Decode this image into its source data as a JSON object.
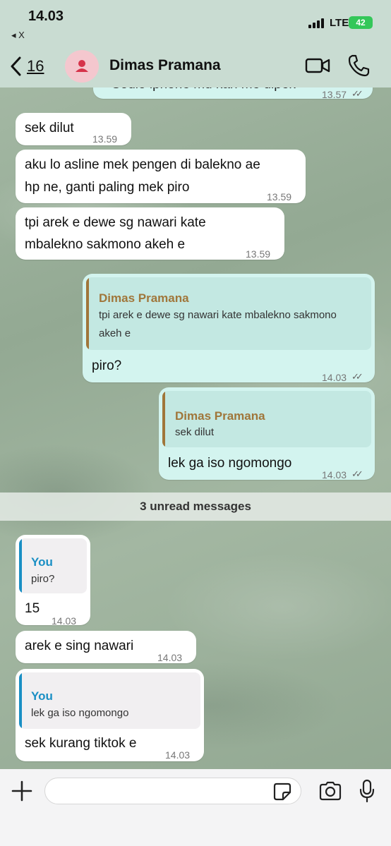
{
  "status_bar": {
    "time": "14.03",
    "back_label": "◂ X",
    "network": "LTE",
    "battery": "42"
  },
  "header": {
    "back_count": "16",
    "contact_name": "Dimas Pramana"
  },
  "messages": [
    {
      "partial_text": "Sodio iphone mu kan me dipek",
      "time": "13.57"
    },
    {
      "text": "sek dilut",
      "time": "13.59"
    },
    {
      "line1": "aku lo asline mek pengen di balekno ae",
      "line2": "hp ne, ganti paling mek piro",
      "time": "13.59"
    },
    {
      "line1": "tpi arek e dewe sg nawari kate",
      "line2": "mbalekno sakmono akeh e",
      "time": "13.59"
    },
    {
      "quote_name": "Dimas Pramana",
      "quote_line1": "tpi arek e dewe sg nawari kate mbalekno sakmono",
      "quote_line2": "akeh e",
      "text": "piro?",
      "time": "14.03"
    },
    {
      "quote_name": "Dimas Pramana",
      "quote_text": "sek dilut",
      "text": "lek ga iso ngomongo",
      "time": "14.03"
    },
    {
      "quote_name": "You",
      "quote_text": "piro?",
      "text": "15",
      "time": "14.03"
    },
    {
      "text": "arek e sing nawari",
      "time": "14.03"
    },
    {
      "quote_name": "You",
      "quote_text": "lek ga iso ngomongo",
      "text": "sek kurang tiktok e",
      "time": "14.03"
    }
  ],
  "unread_divider": "3 unread messages",
  "input": {
    "value": ""
  },
  "icons": [
    "back-chevron-icon",
    "person-icon",
    "video-camera-icon",
    "phone-icon",
    "plus-icon",
    "sticker-icon",
    "camera-icon",
    "microphone-icon"
  ],
  "colors": {
    "outgoing_bubble": "#d3f4ef",
    "incoming_bubble": "#ffffff",
    "quote_contact": "#a0763a",
    "quote_you": "#1a8fc4",
    "avatar": "#f4c7ce",
    "avatar_icon": "#d6334a"
  }
}
